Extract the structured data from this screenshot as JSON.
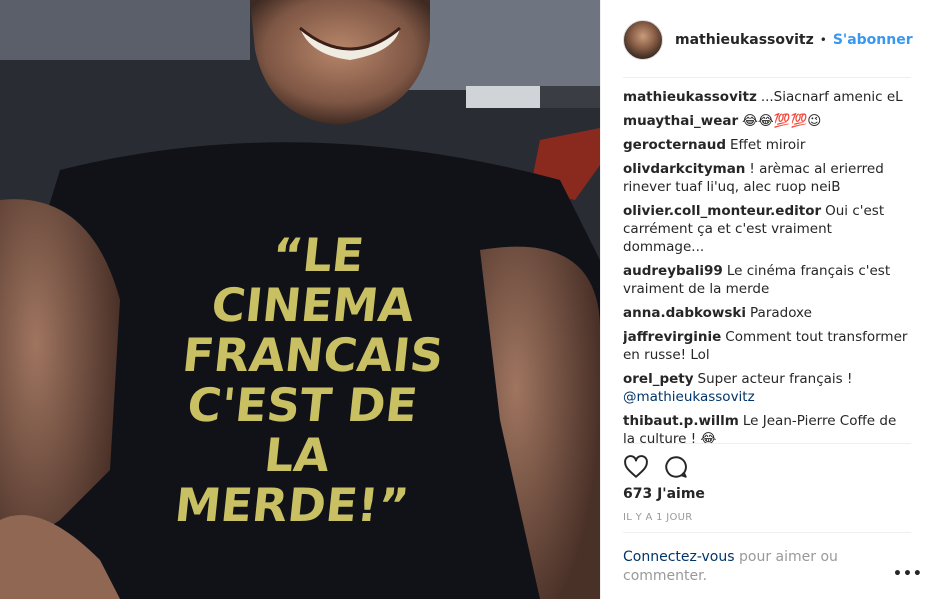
{
  "post": {
    "username": "mathieukassovitz",
    "separator": "•",
    "follow_label": "S'abonner",
    "likes": "673 J'aime",
    "timestamp": "IL Y A 1 JOUR",
    "login_link": "Connectez-vous",
    "login_rest": " pour aimer ou commenter.",
    "more": "•••"
  },
  "photo": {
    "shirt_text": "“LE CINEMA FRANCAIS C'EST DE LA MERDE!”"
  },
  "comments": [
    {
      "author": "mathieukassovitz",
      "text": "...Siacnarf amenic eL"
    },
    {
      "author": "muaythai_wear",
      "text": "😂😂💯💯😉"
    },
    {
      "author": "gerocternaud",
      "text": "Effet miroir"
    },
    {
      "author": "olivdarkcityman",
      "text": "! arèmac al erierred rinever tuaf li'uq, alec ruop neiB"
    },
    {
      "author": "olivier.coll_monteur.editor",
      "text": "Oui c'est carrément ça et c'est vraiment dommage..."
    },
    {
      "author": "audreybali99",
      "text": "Le cinéma français c'est vraiment de la merde"
    },
    {
      "author": "anna.dabkowski",
      "text": "Paradoxe"
    },
    {
      "author": "jaffrevirginie",
      "text": "Comment tout transformer en russe! Lol"
    },
    {
      "author": "orel_pety",
      "text": "Super acteur français !",
      "mention": "@mathieukassovitz"
    },
    {
      "author": "thibaut.p.willm",
      "text": "Le Jean-Pierre Coffe de la culture ! 😂"
    }
  ],
  "colors": {
    "accent": "#3897f0",
    "link": "#003569",
    "muted": "#999999",
    "text": "#262626",
    "shirt_print": "#d9cf6a"
  },
  "icons": [
    "heart-icon",
    "comment-icon"
  ]
}
